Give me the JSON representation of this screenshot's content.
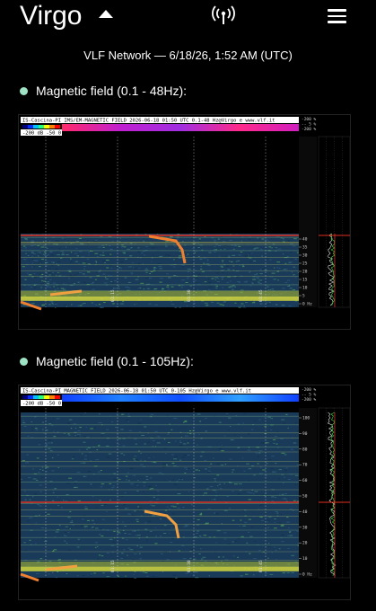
{
  "app": {
    "title": "Virgo"
  },
  "subtitle": "VLF Network — 6/18/26, 1:52 AM (UTC)",
  "sections": [
    {
      "label": "Magnetic field (0.1 - 48Hz):",
      "header_text": "IS-Cascina-PI IMS/EM-MAGNETIC FIELD 2026-06-18 01:50 UTC 0.1-48 Hz@Virgo e www.vlf.it",
      "scale_text": "-200 dB  -50  0",
      "level_labels": [
        "-200 %",
        "-- 5 %",
        "-200 %"
      ],
      "hz_axis": [
        "40",
        "35",
        "30",
        "25",
        "20",
        "15",
        "10",
        "5",
        "0 Hz"
      ],
      "time_labels": [
        "01:15",
        "01:30",
        "01:45"
      ]
    },
    {
      "label": "Magnetic field (0.1 - 105Hz):",
      "header_text": "IS-Cascina-PI MAGNETIC FIELD 2026-06-18 01:50 UTC 0-105 Hz@Virgo e www.vlf.it",
      "scale_text": "-200 dB  -50  0",
      "level_labels": [
        "-200 %",
        "-- 5 %",
        "-200 %"
      ],
      "hz_axis": [
        "100",
        "90",
        "80",
        "70",
        "60",
        "50",
        "40",
        "30",
        "20",
        "10",
        "0 Hz"
      ],
      "time_labels": [
        "01:15",
        "01:30",
        "01:45"
      ]
    }
  ],
  "colors": {
    "accent_dot": "#9fe3c5",
    "background": "#000000"
  }
}
